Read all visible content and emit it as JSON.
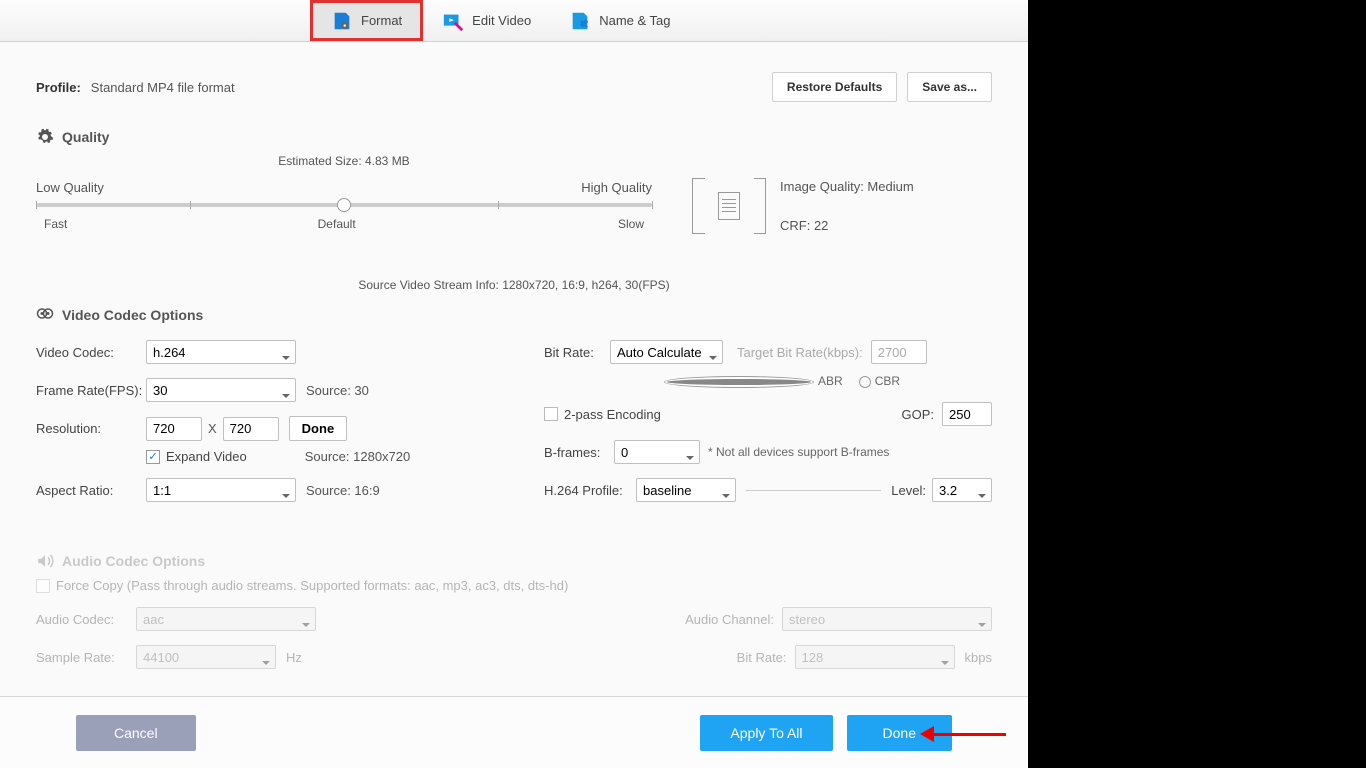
{
  "tabs": {
    "format": "Format",
    "edit": "Edit Video",
    "tag": "Name & Tag"
  },
  "profile": {
    "label": "Profile:",
    "value": "Standard MP4 file format"
  },
  "buttons": {
    "restore": "Restore Defaults",
    "saveas": "Save as...",
    "done_small": "Done",
    "cancel": "Cancel",
    "apply_all": "Apply To All",
    "done": "Done"
  },
  "quality": {
    "heading": "Quality",
    "est_size": "Estimated Size: 4.83 MB",
    "low": "Low Quality",
    "high": "High Quality",
    "fast": "Fast",
    "default": "Default",
    "slow": "Slow",
    "image_quality": "Image Quality: Medium",
    "crf": "CRF: 22"
  },
  "stream_info": "Source Video Stream Info: 1280x720, 16:9, h264, 30(FPS)",
  "video": {
    "heading": "Video Codec Options",
    "codec_lbl": "Video Codec:",
    "codec_val": "h.264",
    "fps_lbl": "Frame Rate(FPS):",
    "fps_val": "30",
    "fps_src": "Source: 30",
    "res_lbl": "Resolution:",
    "res_w": "720",
    "res_h": "720",
    "res_src": "Source: 1280x720",
    "expand": "Expand Video",
    "ar_lbl": "Aspect Ratio:",
    "ar_val": "1:1",
    "ar_src": "Source: 16:9",
    "br_lbl": "Bit Rate:",
    "br_val": "Auto Calculate",
    "tbr_lbl": "Target Bit Rate(kbps):",
    "tbr_val": "2700",
    "abr": "ABR",
    "cbr": "CBR",
    "twopass": "2-pass Encoding",
    "gop_lbl": "GOP:",
    "gop_val": "250",
    "bframes_lbl": "B-frames:",
    "bframes_val": "0",
    "bframes_note": "* Not all devices support B-frames",
    "profile_lbl": "H.264 Profile:",
    "profile_val": "baseline",
    "level_lbl": "Level:",
    "level_val": "3.2"
  },
  "audio": {
    "heading": "Audio Codec Options",
    "force_copy": "Force Copy (Pass through audio streams. Supported formats: aac, mp3, ac3, dts, dts-hd)",
    "codec_lbl": "Audio Codec:",
    "codec_val": "aac",
    "channel_lbl": "Audio Channel:",
    "channel_val": "stereo",
    "sr_lbl": "Sample Rate:",
    "sr_val": "44100",
    "sr_unit": "Hz",
    "br_lbl": "Bit Rate:",
    "br_val": "128",
    "br_unit": "kbps"
  },
  "x": "X"
}
